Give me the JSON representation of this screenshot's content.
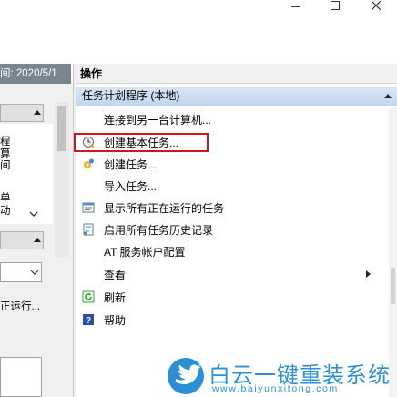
{
  "window": {
    "minimize_icon": "minimize-icon",
    "maximize_icon": "maximize-icon",
    "close_icon": "close-icon"
  },
  "left_pane": {
    "top_strip_text": "间: 2020/5/1",
    "truncated_lines": [
      "程",
      "算",
      "间"
    ],
    "truncated_lines2": [
      "单",
      "动"
    ],
    "running_text": "正运行..."
  },
  "actions": {
    "header": "操作",
    "section_title": "任务计划程序 (本地)",
    "items": [
      {
        "label": "连接到另一台计算机...",
        "icon": ""
      },
      {
        "label": "创建基本任务...",
        "icon": "clock-wizard-icon"
      },
      {
        "label": "创建任务...",
        "icon": "task-gear-icon"
      },
      {
        "label": "导入任务...",
        "icon": ""
      },
      {
        "label": "显示所有正在运行的任务",
        "icon": "running-tasks-icon"
      },
      {
        "label": "启用所有任务历史记录",
        "icon": "history-icon"
      },
      {
        "label": "AT 服务帐户配置",
        "icon": ""
      },
      {
        "label": "查看",
        "icon": ""
      },
      {
        "label": "刷新",
        "icon": "refresh-icon"
      },
      {
        "label": "帮助",
        "icon": "help-icon"
      }
    ]
  },
  "watermark": {
    "brand": "白云一键重装系统",
    "url": "www.baiyunxitong.com"
  },
  "colors": {
    "highlight": "#d4141c",
    "section_header": "#c9dbf0",
    "watermark_blue": "#2a8fd6"
  }
}
